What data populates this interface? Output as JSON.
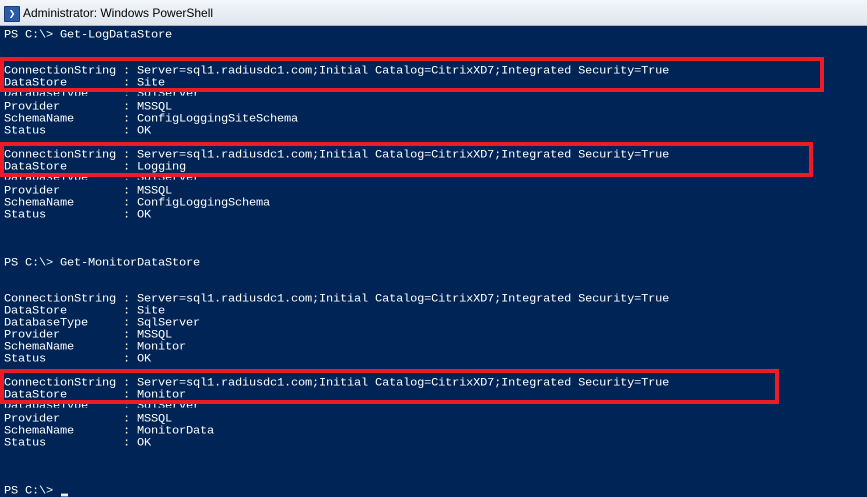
{
  "window": {
    "title": "Administrator: Windows PowerShell",
    "icon": "powershell-icon",
    "background": "#012456",
    "foreground": "#ffffff"
  },
  "console": {
    "lines": [
      "PS C:\\> Get-LogDataStore",
      "",
      "",
      "ConnectionString : Server=sql1.radiusdc1.com;Initial Catalog=CitrixXD7;Integrated Security=True",
      "DataStore        : Site",
      "DatabaseType     : SqlServer",
      "Provider         : MSSQL",
      "SchemaName       : ConfigLoggingSiteSchema",
      "Status           : OK",
      "",
      "ConnectionString : Server=sql1.radiusdc1.com;Initial Catalog=CitrixXD7;Integrated Security=True",
      "DataStore        : Logging",
      "DatabaseType     : SqlServer",
      "Provider         : MSSQL",
      "SchemaName       : ConfigLoggingSchema",
      "Status           : OK",
      "",
      "",
      "",
      "PS C:\\> Get-MonitorDataStore",
      "",
      "",
      "ConnectionString : Server=sql1.radiusdc1.com;Initial Catalog=CitrixXD7;Integrated Security=True",
      "DataStore        : Site",
      "DatabaseType     : SqlServer",
      "Provider         : MSSQL",
      "SchemaName       : Monitor",
      "Status           : OK",
      "",
      "ConnectionString : Server=sql1.radiusdc1.com;Initial Catalog=CitrixXD7;Integrated Security=True",
      "DataStore        : Monitor",
      "DatabaseType     : SqlServer",
      "Provider         : MSSQL",
      "SchemaName       : MonitorData",
      "Status           : OK",
      "",
      "",
      "",
      "PS C:\\> "
    ],
    "cursor_color": "#eeedf0"
  },
  "highlights": {
    "color": "#ed1c24",
    "boxes": [
      "Site connection",
      "Logging connection",
      "Monitor connection"
    ]
  }
}
